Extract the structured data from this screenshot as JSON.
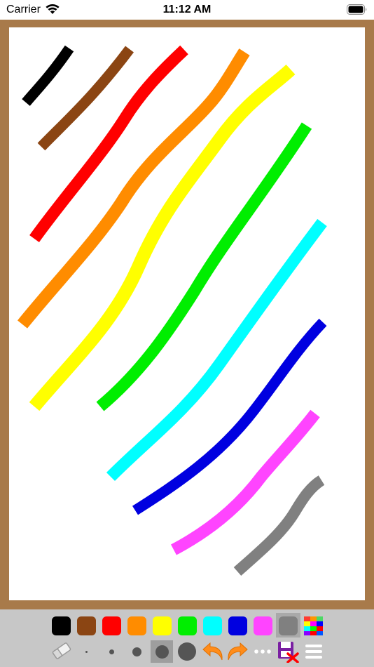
{
  "status_bar": {
    "carrier": "Carrier",
    "time": "11:12 AM",
    "wifi_icon": "wifi-icon",
    "battery_icon": "battery-icon"
  },
  "canvas": {
    "background": "#ffffff",
    "frame_color": "#a87a4a",
    "strokes": [
      {
        "color": "#000000",
        "name": "black"
      },
      {
        "color": "#8b4513",
        "name": "brown"
      },
      {
        "color": "#ff0000",
        "name": "red"
      },
      {
        "color": "#ff8c00",
        "name": "orange"
      },
      {
        "color": "#ffff00",
        "name": "yellow"
      },
      {
        "color": "#00ee00",
        "name": "green"
      },
      {
        "color": "#00ffff",
        "name": "cyan"
      },
      {
        "color": "#0000e0",
        "name": "blue"
      },
      {
        "color": "#ff44ff",
        "name": "magenta"
      },
      {
        "color": "#808080",
        "name": "gray"
      }
    ]
  },
  "palette": {
    "colors": [
      "#000000",
      "#8b4513",
      "#ff0000",
      "#ff8c00",
      "#ffff00",
      "#00ee00",
      "#00ffff",
      "#0000e0",
      "#ff44ff",
      "#808080"
    ],
    "selected_color": "#808080",
    "grid_icon": "color-grid-icon"
  },
  "tools": {
    "eraser": "eraser-icon",
    "brush_sizes": [
      "tiny",
      "small",
      "medium",
      "large",
      "xlarge"
    ],
    "selected_size": "large",
    "undo": "undo-icon",
    "redo": "redo-icon",
    "more": "more-icon",
    "save_clear": "save-clear-icon",
    "menu": "menu-icon"
  }
}
